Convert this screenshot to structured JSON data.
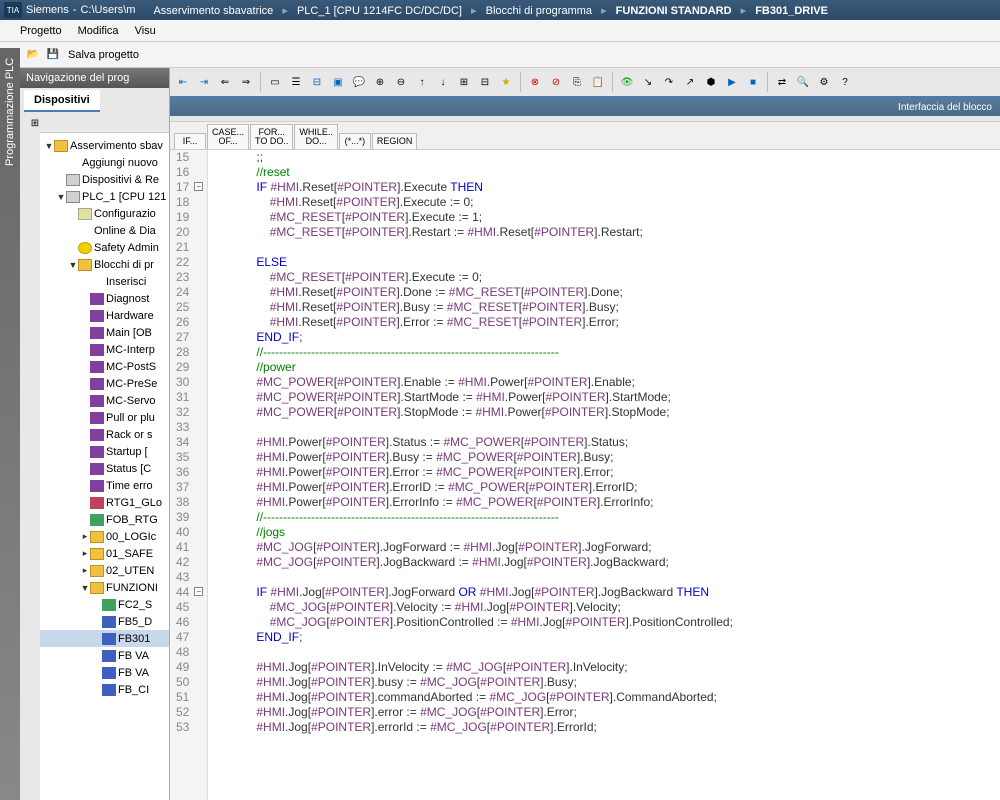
{
  "titlebar": {
    "app": "Siemens",
    "path": "C:\\Users\\m",
    "bc": [
      "Asservimento sbavatrice",
      "PLC_1 [CPU 1214FC DC/DC/DC]",
      "Blocchi di programma",
      "FUNZIONI STANDARD",
      "FB301_DRIVE"
    ]
  },
  "menu": {
    "items": [
      "Progetto",
      "Modifica",
      "Visu"
    ],
    "save": "Salva progetto"
  },
  "nav": {
    "title": "Navigazione del prog",
    "tab": "Dispositivi"
  },
  "sidebar_label": "Programmazione PLC",
  "tree": [
    {
      "ind": 0,
      "tw": "▼",
      "ico": "ico-folder",
      "txt": "Asservimento sbav"
    },
    {
      "ind": 1,
      "tw": "",
      "ico": "ico-add",
      "txt": "Aggiungi nuovo"
    },
    {
      "ind": 1,
      "tw": "",
      "ico": "ico-dev",
      "txt": "Dispositivi & Re"
    },
    {
      "ind": 1,
      "tw": "▼",
      "ico": "ico-dev",
      "txt": "PLC_1 [CPU 121"
    },
    {
      "ind": 2,
      "tw": "",
      "ico": "ico-cfg",
      "txt": "Configurazio"
    },
    {
      "ind": 2,
      "tw": "",
      "ico": "ico-onl",
      "txt": "Online & Dia"
    },
    {
      "ind": 2,
      "tw": "",
      "ico": "ico-safe",
      "txt": "Safety Admin"
    },
    {
      "ind": 2,
      "tw": "▼",
      "ico": "ico-folder",
      "txt": "Blocchi di pr"
    },
    {
      "ind": 3,
      "tw": "",
      "ico": "ico-add",
      "txt": "Inserisci"
    },
    {
      "ind": 3,
      "tw": "",
      "ico": "ico-ob",
      "txt": "Diagnost"
    },
    {
      "ind": 3,
      "tw": "",
      "ico": "ico-ob",
      "txt": "Hardware"
    },
    {
      "ind": 3,
      "tw": "",
      "ico": "ico-ob",
      "txt": "Main [OB"
    },
    {
      "ind": 3,
      "tw": "",
      "ico": "ico-ob",
      "txt": "MC-Interp"
    },
    {
      "ind": 3,
      "tw": "",
      "ico": "ico-ob",
      "txt": "MC-PostS"
    },
    {
      "ind": 3,
      "tw": "",
      "ico": "ico-ob",
      "txt": "MC-PreSe"
    },
    {
      "ind": 3,
      "tw": "",
      "ico": "ico-ob",
      "txt": "MC-Servo"
    },
    {
      "ind": 3,
      "tw": "",
      "ico": "ico-ob",
      "txt": "Pull or plu"
    },
    {
      "ind": 3,
      "tw": "",
      "ico": "ico-ob",
      "txt": "Rack or s"
    },
    {
      "ind": 3,
      "tw": "",
      "ico": "ico-ob",
      "txt": "Startup ["
    },
    {
      "ind": 3,
      "tw": "",
      "ico": "ico-ob",
      "txt": "Status [C"
    },
    {
      "ind": 3,
      "tw": "",
      "ico": "ico-ob",
      "txt": "Time erro"
    },
    {
      "ind": 3,
      "tw": "",
      "ico": "ico-db",
      "txt": "RTG1_GLo"
    },
    {
      "ind": 3,
      "tw": "",
      "ico": "ico-fc",
      "txt": "FOB_RTG"
    },
    {
      "ind": 3,
      "tw": "▸",
      "ico": "ico-folder",
      "txt": "00_LOGIc"
    },
    {
      "ind": 3,
      "tw": "▸",
      "ico": "ico-folder",
      "txt": "01_SAFE"
    },
    {
      "ind": 3,
      "tw": "▸",
      "ico": "ico-folder",
      "txt": "02_UTEN"
    },
    {
      "ind": 3,
      "tw": "▼",
      "ico": "ico-folder",
      "txt": "FUNZIONI"
    },
    {
      "ind": 4,
      "tw": "",
      "ico": "ico-fc",
      "txt": "FC2_S"
    },
    {
      "ind": 4,
      "tw": "",
      "ico": "ico-fb",
      "txt": "FB5_D"
    },
    {
      "ind": 4,
      "tw": "",
      "ico": "ico-fb",
      "txt": "FB301",
      "sel": true
    },
    {
      "ind": 4,
      "tw": "",
      "ico": "ico-fb",
      "txt": "FB VA"
    },
    {
      "ind": 4,
      "tw": "",
      "ico": "ico-fb",
      "txt": "FB VA"
    },
    {
      "ind": 4,
      "tw": "",
      "ico": "ico-fb",
      "txt": "FB_CI"
    }
  ],
  "block_hdr": "Interfaccia del blocco",
  "scl_tabs": [
    "IF...",
    "CASE...\nOF...",
    "FOR...\nTO DO..",
    "WHILE..\nDO...",
    "(*...*)",
    "REGION"
  ],
  "code": {
    "start": 15,
    "lines": [
      [
        [
          "nm",
          "            ;;"
        ]
      ],
      [
        [
          "nm",
          "            "
        ],
        [
          "cm",
          "//reset"
        ]
      ],
      [
        [
          "nm",
          "            "
        ],
        [
          "kw",
          "IF"
        ],
        [
          "nm",
          " "
        ],
        [
          "va",
          "#HMI"
        ],
        [
          "nm",
          ".Reset["
        ],
        [
          "va",
          "#POINTER"
        ],
        [
          "nm",
          "].Execute "
        ],
        [
          "kw",
          "THEN"
        ]
      ],
      [
        [
          "nm",
          "                "
        ],
        [
          "va",
          "#HMI"
        ],
        [
          "nm",
          ".Reset["
        ],
        [
          "va",
          "#POINTER"
        ],
        [
          "nm",
          "].Execute := 0;"
        ]
      ],
      [
        [
          "nm",
          "                "
        ],
        [
          "va",
          "#MC_RESET"
        ],
        [
          "nm",
          "["
        ],
        [
          "va",
          "#POINTER"
        ],
        [
          "nm",
          "].Execute := 1;"
        ]
      ],
      [
        [
          "nm",
          "                "
        ],
        [
          "va",
          "#MC_RESET"
        ],
        [
          "nm",
          "["
        ],
        [
          "va",
          "#POINTER"
        ],
        [
          "nm",
          "].Restart := "
        ],
        [
          "va",
          "#HMI"
        ],
        [
          "nm",
          ".Reset["
        ],
        [
          "va",
          "#POINTER"
        ],
        [
          "nm",
          "].Restart;"
        ]
      ],
      [
        [
          "nm",
          ""
        ]
      ],
      [
        [
          "nm",
          "            "
        ],
        [
          "kw",
          "ELSE"
        ]
      ],
      [
        [
          "nm",
          "                "
        ],
        [
          "va",
          "#MC_RESET"
        ],
        [
          "nm",
          "["
        ],
        [
          "va",
          "#POINTER"
        ],
        [
          "nm",
          "].Execute := 0;"
        ]
      ],
      [
        [
          "nm",
          "                "
        ],
        [
          "va",
          "#HMI"
        ],
        [
          "nm",
          ".Reset["
        ],
        [
          "va",
          "#POINTER"
        ],
        [
          "nm",
          "].Done := "
        ],
        [
          "va",
          "#MC_RESET"
        ],
        [
          "nm",
          "["
        ],
        [
          "va",
          "#POINTER"
        ],
        [
          "nm",
          "].Done;"
        ]
      ],
      [
        [
          "nm",
          "                "
        ],
        [
          "va",
          "#HMI"
        ],
        [
          "nm",
          ".Reset["
        ],
        [
          "va",
          "#POINTER"
        ],
        [
          "nm",
          "].Busy := "
        ],
        [
          "va",
          "#MC_RESET"
        ],
        [
          "nm",
          "["
        ],
        [
          "va",
          "#POINTER"
        ],
        [
          "nm",
          "].Busy;"
        ]
      ],
      [
        [
          "nm",
          "                "
        ],
        [
          "va",
          "#HMI"
        ],
        [
          "nm",
          ".Reset["
        ],
        [
          "va",
          "#POINTER"
        ],
        [
          "nm",
          "].Error := "
        ],
        [
          "va",
          "#MC_RESET"
        ],
        [
          "nm",
          "["
        ],
        [
          "va",
          "#POINTER"
        ],
        [
          "nm",
          "].Error;"
        ]
      ],
      [
        [
          "nm",
          "            "
        ],
        [
          "kw",
          "END_IF"
        ],
        [
          "nm",
          ";"
        ]
      ],
      [
        [
          "nm",
          "            "
        ],
        [
          "cm",
          "//--------------------------------------------------------------------------"
        ]
      ],
      [
        [
          "nm",
          "            "
        ],
        [
          "cm",
          "//power"
        ]
      ],
      [
        [
          "nm",
          "            "
        ],
        [
          "va",
          "#MC_POWER"
        ],
        [
          "nm",
          "["
        ],
        [
          "va",
          "#POINTER"
        ],
        [
          "nm",
          "].Enable := "
        ],
        [
          "va",
          "#HMI"
        ],
        [
          "nm",
          ".Power["
        ],
        [
          "va",
          "#POINTER"
        ],
        [
          "nm",
          "].Enable;"
        ]
      ],
      [
        [
          "nm",
          "            "
        ],
        [
          "va",
          "#MC_POWER"
        ],
        [
          "nm",
          "["
        ],
        [
          "va",
          "#POINTER"
        ],
        [
          "nm",
          "].StartMode := "
        ],
        [
          "va",
          "#HMI"
        ],
        [
          "nm",
          ".Power["
        ],
        [
          "va",
          "#POINTER"
        ],
        [
          "nm",
          "].StartMode;"
        ]
      ],
      [
        [
          "nm",
          "            "
        ],
        [
          "va",
          "#MC_POWER"
        ],
        [
          "nm",
          "["
        ],
        [
          "va",
          "#POINTER"
        ],
        [
          "nm",
          "].StopMode := "
        ],
        [
          "va",
          "#HMI"
        ],
        [
          "nm",
          ".Power["
        ],
        [
          "va",
          "#POINTER"
        ],
        [
          "nm",
          "].StopMode;"
        ]
      ],
      [
        [
          "nm",
          ""
        ]
      ],
      [
        [
          "nm",
          "            "
        ],
        [
          "va",
          "#HMI"
        ],
        [
          "nm",
          ".Power["
        ],
        [
          "va",
          "#POINTER"
        ],
        [
          "nm",
          "].Status := "
        ],
        [
          "va",
          "#MC_POWER"
        ],
        [
          "nm",
          "["
        ],
        [
          "va",
          "#POINTER"
        ],
        [
          "nm",
          "].Status;"
        ]
      ],
      [
        [
          "nm",
          "            "
        ],
        [
          "va",
          "#HMI"
        ],
        [
          "nm",
          ".Power["
        ],
        [
          "va",
          "#POINTER"
        ],
        [
          "nm",
          "].Busy := "
        ],
        [
          "va",
          "#MC_POWER"
        ],
        [
          "nm",
          "["
        ],
        [
          "va",
          "#POINTER"
        ],
        [
          "nm",
          "].Busy;"
        ]
      ],
      [
        [
          "nm",
          "            "
        ],
        [
          "va",
          "#HMI"
        ],
        [
          "nm",
          ".Power["
        ],
        [
          "va",
          "#POINTER"
        ],
        [
          "nm",
          "].Error := "
        ],
        [
          "va",
          "#MC_POWER"
        ],
        [
          "nm",
          "["
        ],
        [
          "va",
          "#POINTER"
        ],
        [
          "nm",
          "].Error;"
        ]
      ],
      [
        [
          "nm",
          "            "
        ],
        [
          "va",
          "#HMI"
        ],
        [
          "nm",
          ".Power["
        ],
        [
          "va",
          "#POINTER"
        ],
        [
          "nm",
          "].ErrorID := "
        ],
        [
          "va",
          "#MC_POWER"
        ],
        [
          "nm",
          "["
        ],
        [
          "va",
          "#POINTER"
        ],
        [
          "nm",
          "].ErrorID;"
        ]
      ],
      [
        [
          "nm",
          "            "
        ],
        [
          "va",
          "#HMI"
        ],
        [
          "nm",
          ".Power["
        ],
        [
          "va",
          "#POINTER"
        ],
        [
          "nm",
          "].ErrorInfo := "
        ],
        [
          "va",
          "#MC_POWER"
        ],
        [
          "nm",
          "["
        ],
        [
          "va",
          "#POINTER"
        ],
        [
          "nm",
          "].ErrorInfo;"
        ]
      ],
      [
        [
          "nm",
          "            "
        ],
        [
          "cm",
          "//--------------------------------------------------------------------------"
        ]
      ],
      [
        [
          "nm",
          "            "
        ],
        [
          "cm",
          "//jogs"
        ]
      ],
      [
        [
          "nm",
          "            "
        ],
        [
          "va",
          "#MC_JOG"
        ],
        [
          "nm",
          "["
        ],
        [
          "va",
          "#POINTER"
        ],
        [
          "nm",
          "].JogForward := "
        ],
        [
          "va",
          "#HMI"
        ],
        [
          "nm",
          ".Jog["
        ],
        [
          "va",
          "#POINTER"
        ],
        [
          "nm",
          "].JogForward;"
        ]
      ],
      [
        [
          "nm",
          "            "
        ],
        [
          "va",
          "#MC_JOG"
        ],
        [
          "nm",
          "["
        ],
        [
          "va",
          "#POINTER"
        ],
        [
          "nm",
          "].JogBackward := "
        ],
        [
          "va",
          "#HMI"
        ],
        [
          "nm",
          ".Jog["
        ],
        [
          "va",
          "#POINTER"
        ],
        [
          "nm",
          "].JogBackward;"
        ]
      ],
      [
        [
          "nm",
          ""
        ]
      ],
      [
        [
          "nm",
          "            "
        ],
        [
          "kw",
          "IF"
        ],
        [
          "nm",
          " "
        ],
        [
          "va",
          "#HMI"
        ],
        [
          "nm",
          ".Jog["
        ],
        [
          "va",
          "#POINTER"
        ],
        [
          "nm",
          "].JogForward "
        ],
        [
          "kw",
          "OR"
        ],
        [
          "nm",
          " "
        ],
        [
          "va",
          "#HMI"
        ],
        [
          "nm",
          ".Jog["
        ],
        [
          "va",
          "#POINTER"
        ],
        [
          "nm",
          "].JogBackward "
        ],
        [
          "kw",
          "THEN"
        ]
      ],
      [
        [
          "nm",
          "                "
        ],
        [
          "va",
          "#MC_JOG"
        ],
        [
          "nm",
          "["
        ],
        [
          "va",
          "#POINTER"
        ],
        [
          "nm",
          "].Velocity := "
        ],
        [
          "va",
          "#HMI"
        ],
        [
          "nm",
          ".Jog["
        ],
        [
          "va",
          "#POINTER"
        ],
        [
          "nm",
          "].Velocity;"
        ]
      ],
      [
        [
          "nm",
          "                "
        ],
        [
          "va",
          "#MC_JOG"
        ],
        [
          "nm",
          "["
        ],
        [
          "va",
          "#POINTER"
        ],
        [
          "nm",
          "].PositionControlled := "
        ],
        [
          "va",
          "#HMI"
        ],
        [
          "nm",
          ".Jog["
        ],
        [
          "va",
          "#POINTER"
        ],
        [
          "nm",
          "].PositionControlled;"
        ]
      ],
      [
        [
          "nm",
          "            "
        ],
        [
          "kw",
          "END_IF"
        ],
        [
          "nm",
          ";"
        ]
      ],
      [
        [
          "nm",
          ""
        ]
      ],
      [
        [
          "nm",
          "            "
        ],
        [
          "va",
          "#HMI"
        ],
        [
          "nm",
          ".Jog["
        ],
        [
          "va",
          "#POINTER"
        ],
        [
          "nm",
          "].InVelocity := "
        ],
        [
          "va",
          "#MC_JOG"
        ],
        [
          "nm",
          "["
        ],
        [
          "va",
          "#POINTER"
        ],
        [
          "nm",
          "].InVelocity;"
        ]
      ],
      [
        [
          "nm",
          "            "
        ],
        [
          "va",
          "#HMI"
        ],
        [
          "nm",
          ".Jog["
        ],
        [
          "va",
          "#POINTER"
        ],
        [
          "nm",
          "].busy := "
        ],
        [
          "va",
          "#MC_JOG"
        ],
        [
          "nm",
          "["
        ],
        [
          "va",
          "#POINTER"
        ],
        [
          "nm",
          "].Busy;"
        ]
      ],
      [
        [
          "nm",
          "            "
        ],
        [
          "va",
          "#HMI"
        ],
        [
          "nm",
          ".Jog["
        ],
        [
          "va",
          "#POINTER"
        ],
        [
          "nm",
          "].commandAborted := "
        ],
        [
          "va",
          "#MC_JOG"
        ],
        [
          "nm",
          "["
        ],
        [
          "va",
          "#POINTER"
        ],
        [
          "nm",
          "].CommandAborted;"
        ]
      ],
      [
        [
          "nm",
          "            "
        ],
        [
          "va",
          "#HMI"
        ],
        [
          "nm",
          ".Jog["
        ],
        [
          "va",
          "#POINTER"
        ],
        [
          "nm",
          "].error := "
        ],
        [
          "va",
          "#MC_JOG"
        ],
        [
          "nm",
          "["
        ],
        [
          "va",
          "#POINTER"
        ],
        [
          "nm",
          "].Error;"
        ]
      ],
      [
        [
          "nm",
          "            "
        ],
        [
          "va",
          "#HMI"
        ],
        [
          "nm",
          ".Jog["
        ],
        [
          "va",
          "#POINTER"
        ],
        [
          "nm",
          "].errorId := "
        ],
        [
          "va",
          "#MC_JOG"
        ],
        [
          "nm",
          "["
        ],
        [
          "va",
          "#POINTER"
        ],
        [
          "nm",
          "].ErrorId;"
        ]
      ]
    ],
    "folds": [
      17,
      44
    ]
  }
}
